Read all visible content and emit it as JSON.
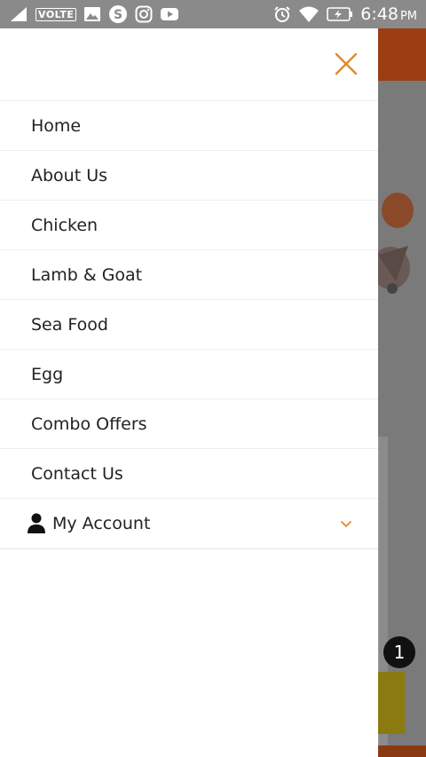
{
  "statusbar": {
    "carrier_badge": "VOLTE",
    "time": "6:48",
    "ampm": "PM",
    "icons": [
      "signal-icon",
      "volte-badge",
      "gallery-icon",
      "skype-icon",
      "instagram-icon",
      "youtube-icon",
      "alarm-icon",
      "wifi-icon",
      "battery-charging-icon"
    ]
  },
  "drawer": {
    "close_icon": "close-icon",
    "accent_color": "#e08a2c",
    "items": [
      {
        "label": "Home"
      },
      {
        "label": "About Us"
      },
      {
        "label": "Chicken"
      },
      {
        "label": "Lamb & Goat"
      },
      {
        "label": "Sea Food"
      },
      {
        "label": "Egg"
      },
      {
        "label": "Combo Offers"
      },
      {
        "label": "Contact Us"
      }
    ],
    "account": {
      "label": "My Account",
      "icon": "user-icon",
      "toggle_icon": "chevron-down-icon"
    }
  },
  "background": {
    "cart_badge_count": "1"
  }
}
